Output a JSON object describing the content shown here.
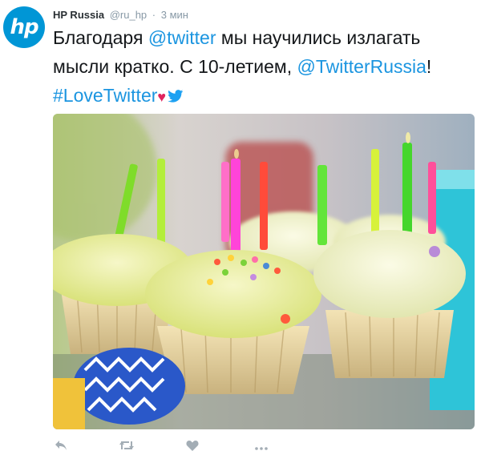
{
  "tweet": {
    "author_name": "HP Russia",
    "handle": "@ru_hp",
    "separator": "·",
    "time": "3 мин",
    "text": {
      "part1": "Благодаря ",
      "mention_twitter": "@twitter",
      "part2": " мы научились излагать мысли кратко. С 10-летием, ",
      "mention_russia": "@TwitterRussia",
      "part3": "! ",
      "hashtag": "#LoveTwitter",
      "heart": "♥"
    }
  },
  "avatar": {
    "logo_text": "hp",
    "color": "#0096d6"
  },
  "colors": {
    "link": "#1b95e0",
    "muted": "#8899a6",
    "heart": "#e0245e"
  },
  "photo": {
    "subject": "cupcakes with birthday candles"
  },
  "actions": [
    {
      "icon": "reply-icon"
    },
    {
      "icon": "retweet-icon"
    },
    {
      "icon": "like-icon"
    },
    {
      "icon": "more-icon"
    }
  ]
}
